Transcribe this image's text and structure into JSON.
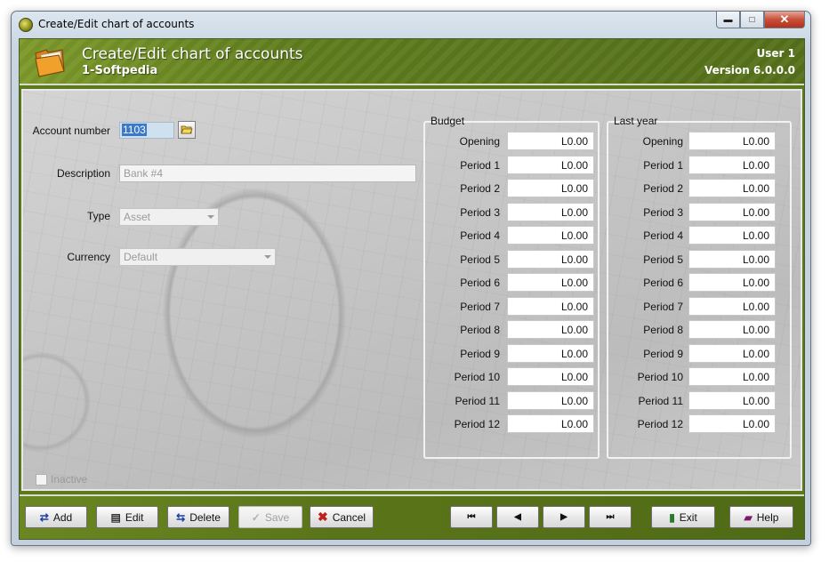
{
  "window": {
    "title": "Create/Edit chart of accounts"
  },
  "header": {
    "title": "Create/Edit chart of accounts",
    "company": "1-Softpedia",
    "user": "User 1",
    "version": "Version 6.0.0.0"
  },
  "form": {
    "account_number_label": "Account number",
    "account_number_value": "1103",
    "description_label": "Description",
    "description_value": "Bank #4",
    "type_label": "Type",
    "type_value": "Asset",
    "currency_label": "Currency",
    "currency_value": "Default",
    "inactive_label": "Inactive",
    "inactive_checked": false
  },
  "budget": {
    "title": "Budget",
    "rows": [
      {
        "label": "Opening",
        "value": "L0.00"
      },
      {
        "label": "Period 1",
        "value": "L0.00"
      },
      {
        "label": "Period 2",
        "value": "L0.00"
      },
      {
        "label": "Period 3",
        "value": "L0.00"
      },
      {
        "label": "Period 4",
        "value": "L0.00"
      },
      {
        "label": "Period 5",
        "value": "L0.00"
      },
      {
        "label": "Period 6",
        "value": "L0.00"
      },
      {
        "label": "Period 7",
        "value": "L0.00"
      },
      {
        "label": "Period 8",
        "value": "L0.00"
      },
      {
        "label": "Period 9",
        "value": "L0.00"
      },
      {
        "label": "Period 10",
        "value": "L0.00"
      },
      {
        "label": "Period 11",
        "value": "L0.00"
      },
      {
        "label": "Period 12",
        "value": "L0.00"
      }
    ]
  },
  "last_year": {
    "title": "Last year",
    "rows": [
      {
        "label": "Opening",
        "value": "L0.00"
      },
      {
        "label": "Period 1",
        "value": "L0.00"
      },
      {
        "label": "Period 2",
        "value": "L0.00"
      },
      {
        "label": "Period 3",
        "value": "L0.00"
      },
      {
        "label": "Period 4",
        "value": "L0.00"
      },
      {
        "label": "Period 5",
        "value": "L0.00"
      },
      {
        "label": "Period 6",
        "value": "L0.00"
      },
      {
        "label": "Period 7",
        "value": "L0.00"
      },
      {
        "label": "Period 8",
        "value": "L0.00"
      },
      {
        "label": "Period 9",
        "value": "L0.00"
      },
      {
        "label": "Period 10",
        "value": "L0.00"
      },
      {
        "label": "Period 11",
        "value": "L0.00"
      },
      {
        "label": "Period 12",
        "value": "L0.00"
      }
    ]
  },
  "toolbar": {
    "add": "Add",
    "edit": "Edit",
    "delete": "Delete",
    "save": "Save",
    "cancel": "Cancel",
    "first": "⏮",
    "prev": "◀",
    "next": "▶",
    "last": "⏭",
    "exit": "Exit",
    "help": "Help"
  },
  "colors": {
    "header_green": "#5f7d1e",
    "bar_green": "#5a7519",
    "cancel_red": "#c0201a"
  }
}
